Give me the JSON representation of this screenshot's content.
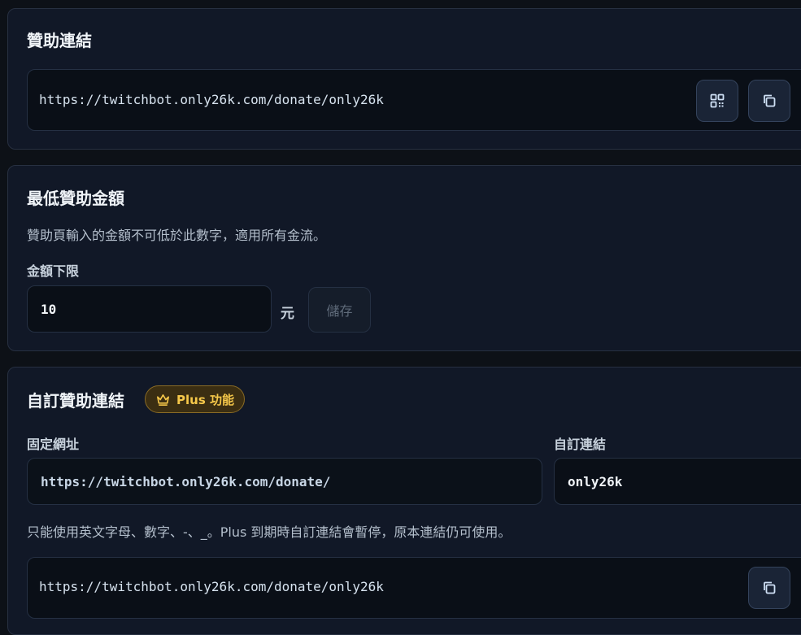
{
  "donate_link": {
    "title": "贊助連結",
    "url": "https://twitchbot.only26k.com/donate/only26k",
    "qr_icon": "qr-code-icon",
    "copy_icon": "copy-icon"
  },
  "min_amount": {
    "title": "最低贊助金額",
    "description": "贊助頁輸入的金額不可低於此數字，適用所有金流。",
    "field_label": "金額下限",
    "value": "10",
    "unit": "元",
    "save_label": "儲存"
  },
  "custom_link": {
    "title": "自訂贊助連結",
    "badge_label": "Plus 功能",
    "badge_icon": "crown-icon",
    "fixed_label": "固定網址",
    "fixed_value": "https://twitchbot.only26k.com/donate/",
    "custom_label": "自訂連結",
    "custom_value": "only26k",
    "hint": "只能使用英文字母、數字、-、_。Plus 到期時自訂連結會暫停，原本連結仍可使用。",
    "result_url": "https://twitchbot.only26k.com/donate/only26k",
    "copy_icon": "copy-icon"
  },
  "colors": {
    "background": "#0d1117",
    "card": "#111827",
    "accent_gold": "#f6c84a"
  }
}
